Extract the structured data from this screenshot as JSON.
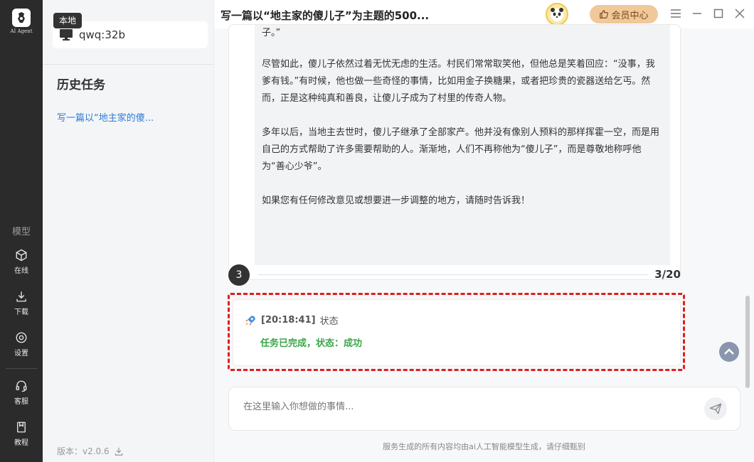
{
  "rail": {
    "logo_text": "AI Agent",
    "section_label": "模型",
    "items": [
      {
        "label": "在线",
        "icon": "cube-icon"
      },
      {
        "label": "下载",
        "icon": "download-icon"
      },
      {
        "label": "设置",
        "icon": "gear-icon"
      },
      {
        "label": "客服",
        "icon": "headset-icon"
      },
      {
        "label": "教程",
        "icon": "book-icon"
      }
    ]
  },
  "sidebar": {
    "local_tag": "本地",
    "model_name": "qwq:32b",
    "history_title": "历史任务",
    "history_items": [
      "写一篇以“地主家的傻..."
    ],
    "version": "版本：v2.0.6"
  },
  "topbar": {
    "title": "写一篇以“地主家的傻儿子”为主题的500...",
    "vip_label": "会员中心"
  },
  "message": {
    "paragraphs": [
      "子。”",
      "尽管如此，傻儿子依然过着无忧无虑的生活。村民们常常取笑他，但他总是笑着回应：“没事，我爹有钱。”有时候，他也做一些奇怪的事情，比如用金子换糖果，或者把珍贵的瓷器送给乞丐。然而，正是这种纯真和善良，让傻儿子成为了村里的传奇人物。",
      "多年以后，当地主去世时，傻儿子继承了全部家产。他并没有像别人预料的那样挥霍一空，而是用自己的方式帮助了许多需要帮助的人。渐渐地，人们不再称他为“傻儿子”，而是尊敬地称呼他为“善心少爷”。",
      "如果您有任何修改意见或想要进一步调整的地方，请随时告诉我！"
    ]
  },
  "step": {
    "number": "3",
    "count": "3/20"
  },
  "status": {
    "time": "[20:18:41]",
    "label": "状态",
    "text": "任务已完成，状态：成功"
  },
  "input": {
    "placeholder": "在这里输入你想做的事情..."
  },
  "footer_note": "服务生成的所有内容均由ai人工智能模型生成，请仔细甄别",
  "colors": {
    "rail_bg": "#2b2b2b",
    "link": "#2b7cd3",
    "success": "#3aa64a",
    "highlight_border": "#e11d1d",
    "vip_bg": "#f1c89a"
  }
}
